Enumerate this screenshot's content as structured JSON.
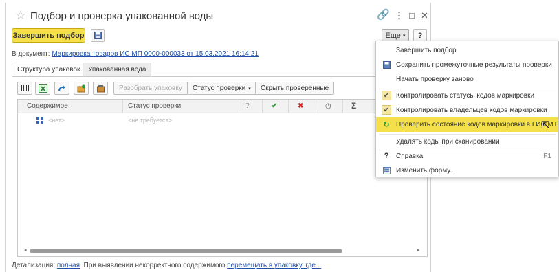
{
  "window": {
    "title": "Подбор и проверка упакованной воды",
    "controls": {
      "link": "🔗",
      "more": "⋮",
      "maximize": "□",
      "close": "✕"
    }
  },
  "toolbar": {
    "finish_label": "Завершить подбор",
    "save_icon": "save-icon",
    "more_label": "Еще",
    "help_label": "?"
  },
  "document": {
    "prefix": "В документ:",
    "link": "Маркировка товаров ИС МП 0000-000033 от 15.03.2021 16:14:21"
  },
  "tabs": [
    {
      "label": "Структура упаковок",
      "active": true
    },
    {
      "label": "Упакованная вода",
      "active": false
    }
  ],
  "grid_toolbar": {
    "unpack_label": "Разобрать упаковку",
    "status_label": "Статус проверки",
    "hide_label": "Скрыть проверенные"
  },
  "grid": {
    "columns": [
      {
        "label": "Содержимое"
      },
      {
        "label": "Статус проверки"
      },
      {
        "label": "?"
      },
      {
        "label": "✔"
      },
      {
        "label": "✖"
      },
      {
        "label": "◷"
      },
      {
        "label": "Σ"
      }
    ],
    "rows": [
      {
        "content": "<нет>",
        "status": "<не требуется>"
      }
    ]
  },
  "footer": {
    "detail_prefix": "Детализация:",
    "detail_link": "полная",
    "middle_text": ". При выявлении некорректного содержимого",
    "action_link": "перемещать в упаковку, где..."
  },
  "menu": {
    "items": [
      {
        "label": "Завершить подбор",
        "icon": "",
        "checked": false
      },
      {
        "label": "Сохранить промежуточные результаты проверки",
        "icon": "save-icon"
      },
      {
        "label": "Начать проверку заново",
        "icon": ""
      },
      {
        "label": "Контролировать статусы кодов маркировки",
        "icon": "check-icon",
        "checked": true
      },
      {
        "label": "Контролировать владельцев кодов маркировки",
        "icon": "check-icon",
        "checked": true
      },
      {
        "label": "Проверить состояние кодов маркировки в ГИС МТ",
        "icon": "refresh-icon",
        "highlighted": true
      },
      {
        "label": "Удалять коды при сканировании",
        "icon": ""
      },
      {
        "label": "Справка",
        "icon": "help-icon",
        "shortcut": "F1"
      },
      {
        "label": "Изменить форму...",
        "icon": "form-icon"
      }
    ]
  },
  "colors": {
    "accent_yellow": "#f4e04a",
    "link_blue": "#1f4fa8",
    "check_green": "#2e9b3a",
    "cross_red": "#cf2b2b"
  }
}
